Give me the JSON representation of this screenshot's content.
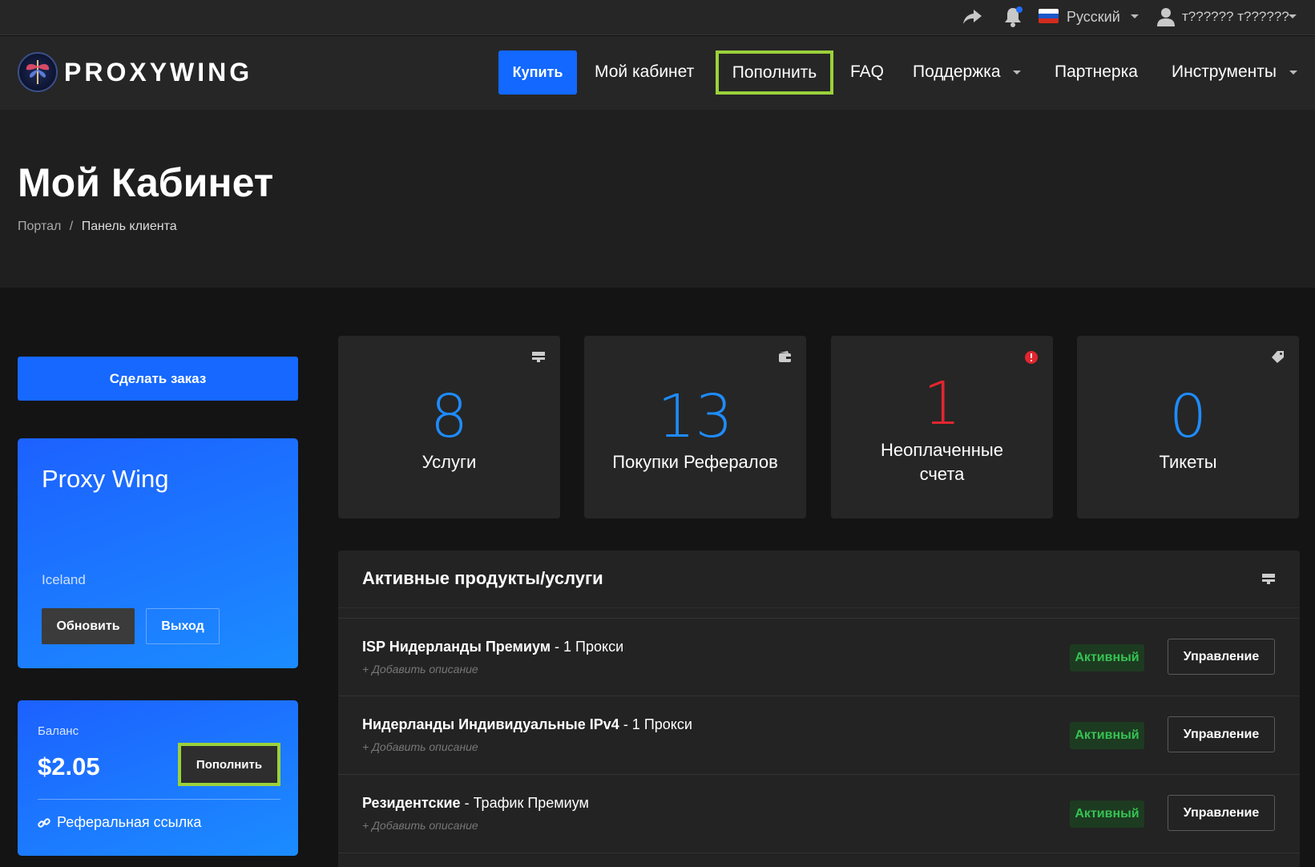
{
  "topbar": {
    "share_icon": "share-icon",
    "bell_icon": "bell-icon",
    "language": "Русский",
    "user_name": "т?????? т??????"
  },
  "nav": {
    "logo": "PROXYWING",
    "buy": "Купить",
    "cabinet": "Мой кабинет",
    "topup": "Пополнить",
    "faq": "FAQ",
    "support": "Поддержка",
    "partner": "Партнерка",
    "tools": "Инструменты"
  },
  "hero": {
    "title": "Мой Кабинет",
    "breadcrumb_home": "Портал",
    "breadcrumb_sep": "/",
    "breadcrumb_current": "Панель клиента"
  },
  "sidebar": {
    "order_button": "Сделать заказ",
    "client_name": "Proxy Wing",
    "client_country": "Iceland",
    "refresh_button": "Обновить",
    "logout_button": "Выход",
    "balance_label": "Баланс",
    "balance_value": "$2.05",
    "topup_button": "Пополнить",
    "referral_link": "Реферальная ссылка"
  },
  "tiles": [
    {
      "value": "8",
      "label": "Услуги",
      "icon": "server-icon"
    },
    {
      "value": "13",
      "label": "Покупки Рефералов",
      "icon": "wallet-icon"
    },
    {
      "value": "1",
      "label_line1": "Неоплаченные",
      "label_line2": "счета",
      "icon": "alert-icon"
    },
    {
      "value": "0",
      "label": "Тикеты",
      "icon": "tag-icon"
    }
  ],
  "products": {
    "title": "Активные продукты/услуги",
    "rows": [
      {
        "name": "ISP Нидерланды Премиум",
        "detail": " - 1 Прокси",
        "desc": "+ Добавить описание",
        "status": "Активный",
        "action": "Управление"
      },
      {
        "name": "Нидерланды Индивидуальные IPv4",
        "detail": " - 1 Прокси",
        "desc": "+ Добавить описание",
        "status": "Активный",
        "action": "Управление"
      },
      {
        "name": "Резидентские",
        "detail": " - Трафик Премиум",
        "desc": "+ Добавить описание",
        "status": "Активный",
        "action": "Управление"
      }
    ]
  },
  "colors": {
    "accent": "#1268ff",
    "highlight": "#9bd13b",
    "stat_blue": "#1e8cff",
    "stat_red": "#e0262f",
    "active_green": "#36c253"
  }
}
